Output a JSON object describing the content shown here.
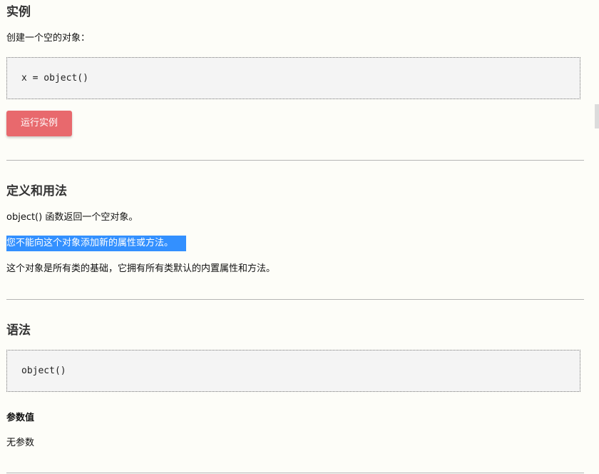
{
  "example": {
    "heading": "实例",
    "description": "创建一个空的对象：",
    "code": "x = object()",
    "run_button": "运行实例"
  },
  "definition": {
    "heading": "定义和用法",
    "line1": "object() 函数返回一个空对象。",
    "line2_highlighted": "您不能向这个对象添加新的属性或方法。",
    "line3": "这个对象是所有类的基础，它拥有所有类默认的内置属性和方法。"
  },
  "syntax": {
    "heading": "语法",
    "code": "object()"
  },
  "params": {
    "heading": "参数值",
    "text": "无参数"
  },
  "colors": {
    "run_button": "#e8696d",
    "selection": "#3390ff",
    "code_background": "#f4f4f4",
    "page_background": "#fdfdf8"
  }
}
